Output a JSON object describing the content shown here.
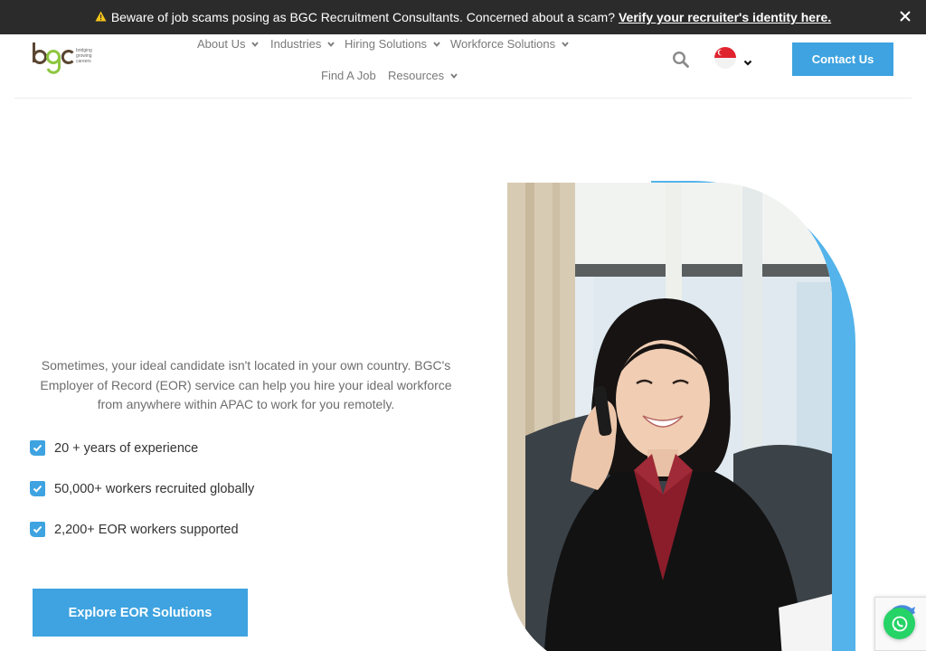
{
  "alert": {
    "icon": "warning-icon",
    "message": "Beware of job scams posing as BGC Recruitment Consultants. Concerned about a scam?",
    "link_text": "Verify your recruiter's identity here."
  },
  "logo": {
    "text": "bgc",
    "tagline": [
      "bridging",
      "growing",
      "careers"
    ]
  },
  "nav": {
    "about": "About Us",
    "industries": "Industries",
    "hiring": "Hiring Solutions",
    "workforce": "Workforce Solutions",
    "find_job": "Find A Job",
    "resources": "Resources"
  },
  "header": {
    "contact_label": "Contact Us",
    "language_flag": "singapore-flag-icon"
  },
  "hero": {
    "intro": "Sometimes, your ideal candidate isn't located in your own country. BGC's Employer of Record (EOR) service can help you hire your ideal workforce from anywhere within APAC to work for you remotely.",
    "checks": [
      "20 + years of experience",
      "50,000+ workers recruited globally",
      "2,200+ EOR workers supported"
    ],
    "cta_label": "Explore EOR Solutions"
  },
  "colors": {
    "accent": "#3ea3e0",
    "alert_bg": "#2b2b2b",
    "whatsapp": "#25d366"
  }
}
